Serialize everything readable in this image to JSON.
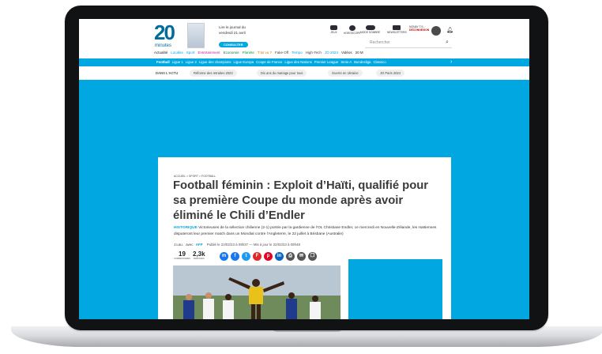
{
  "site": {
    "logo_number": "20",
    "logo_sub": "minutes"
  },
  "promo": {
    "line1": "Lire le journal du",
    "line2": "vendredi 21 avril",
    "button": "CONSULTER"
  },
  "header_icons": [
    {
      "name": "jeux-icon",
      "label": "JEUX"
    },
    {
      "name": "horoscope-icon",
      "label": "HOROSCOPE"
    },
    {
      "name": "mode-sombre-icon",
      "label": "MODE SOMBRE"
    },
    {
      "name": "newsletters-icon",
      "label": "NEWSLETTERS"
    }
  ],
  "account": {
    "name": "NONAY T.S...",
    "status": "DÉCONNEXION"
  },
  "search": {
    "placeholder": "Rechercher"
  },
  "main_nav": [
    {
      "label": "Actualité",
      "color": "#222222"
    },
    {
      "label": "Locales",
      "color": "#00a7e1"
    },
    {
      "label": "Sport",
      "color": "#00a7e1"
    },
    {
      "label": "Entertainment",
      "color": "#c0268b"
    },
    {
      "label": "Economie",
      "color": "#0a7d43"
    },
    {
      "label": "Planète",
      "color": "#0a9b3b"
    },
    {
      "label": "T'as vu ?",
      "color": "#e57200"
    },
    {
      "label": "Fake Off",
      "color": "#444444"
    },
    {
      "label": "Tempo",
      "color": "#00a7e1"
    },
    {
      "label": "High-Tech",
      "color": "#444444"
    },
    {
      "label": "JO 2024",
      "color": "#00a7e1"
    },
    {
      "label": "Vidéos",
      "color": "#222222"
    },
    {
      "label": "20 M",
      "color": "#222222"
    }
  ],
  "sub_nav": [
    "Football",
    "Ligue 1",
    "Ligue 2",
    "Ligue des champions",
    "Ligue Europa",
    "Coupe de France",
    "Ligue des Nations",
    "Premier League",
    "Serie A",
    "Bundesliga",
    "Classico"
  ],
  "dans_lactu": {
    "label": "DANS L'ACTU",
    "items": [
      "Réforme des retraites 2023",
      "Dix ans du mariage pour tous",
      "Guerre en Ukraine",
      "JO Paris 2024"
    ]
  },
  "article": {
    "breadcrumb": "ACCUEIL > SPORT > FOOTBALL",
    "title": "Football féminin : Exploit d’Haïti, qualifié pour sa première Coupe du monde après avoir éliminé le Chili d’Endler",
    "kicker": "HISTORIQUE",
    "chapeau": "Victorieuses de la sélection chilienne (2-1) portée par la gardienne de l’OL Christiane Endler, ce mercredi en Nouvelle-Zélande, les Haïtiennes disputeront leur premier match dans un Mondial contre l’Angleterre, le 22 juillet à Brisbane (Australie)",
    "author": "J.Lau.",
    "with": "avec",
    "agency": "AFP",
    "dates": "Publié le 22/02/23 à 09h37 — Mis à jour le 22/02/23 à 09h48",
    "comments": {
      "value": "19",
      "label": "COMMENTAIRES"
    },
    "shares": {
      "value": "2,3k",
      "label": "PARTAGES"
    }
  },
  "share_buttons": [
    {
      "name": "messenger-icon",
      "glyph": "m",
      "color": "#1877f2"
    },
    {
      "name": "facebook-icon",
      "glyph": "f",
      "color": "#1877f2"
    },
    {
      "name": "twitter-icon",
      "glyph": "t",
      "color": "#1d9bf0"
    },
    {
      "name": "flipboard-icon",
      "glyph": "F",
      "color": "#e12828"
    },
    {
      "name": "pinterest-icon",
      "glyph": "p",
      "color": "#e60023"
    },
    {
      "name": "linkedin-icon",
      "glyph": "in",
      "color": "#0a66c2"
    },
    {
      "name": "print-icon",
      "glyph": "⎙",
      "color": "#555555"
    },
    {
      "name": "email-icon",
      "glyph": "✉",
      "color": "#555555"
    },
    {
      "name": "bookmark-icon",
      "glyph": "❐",
      "color": "#555555"
    }
  ],
  "colors": {
    "brand": "#00a7e1",
    "logo": "#006c9b",
    "bezel": "#111214"
  }
}
